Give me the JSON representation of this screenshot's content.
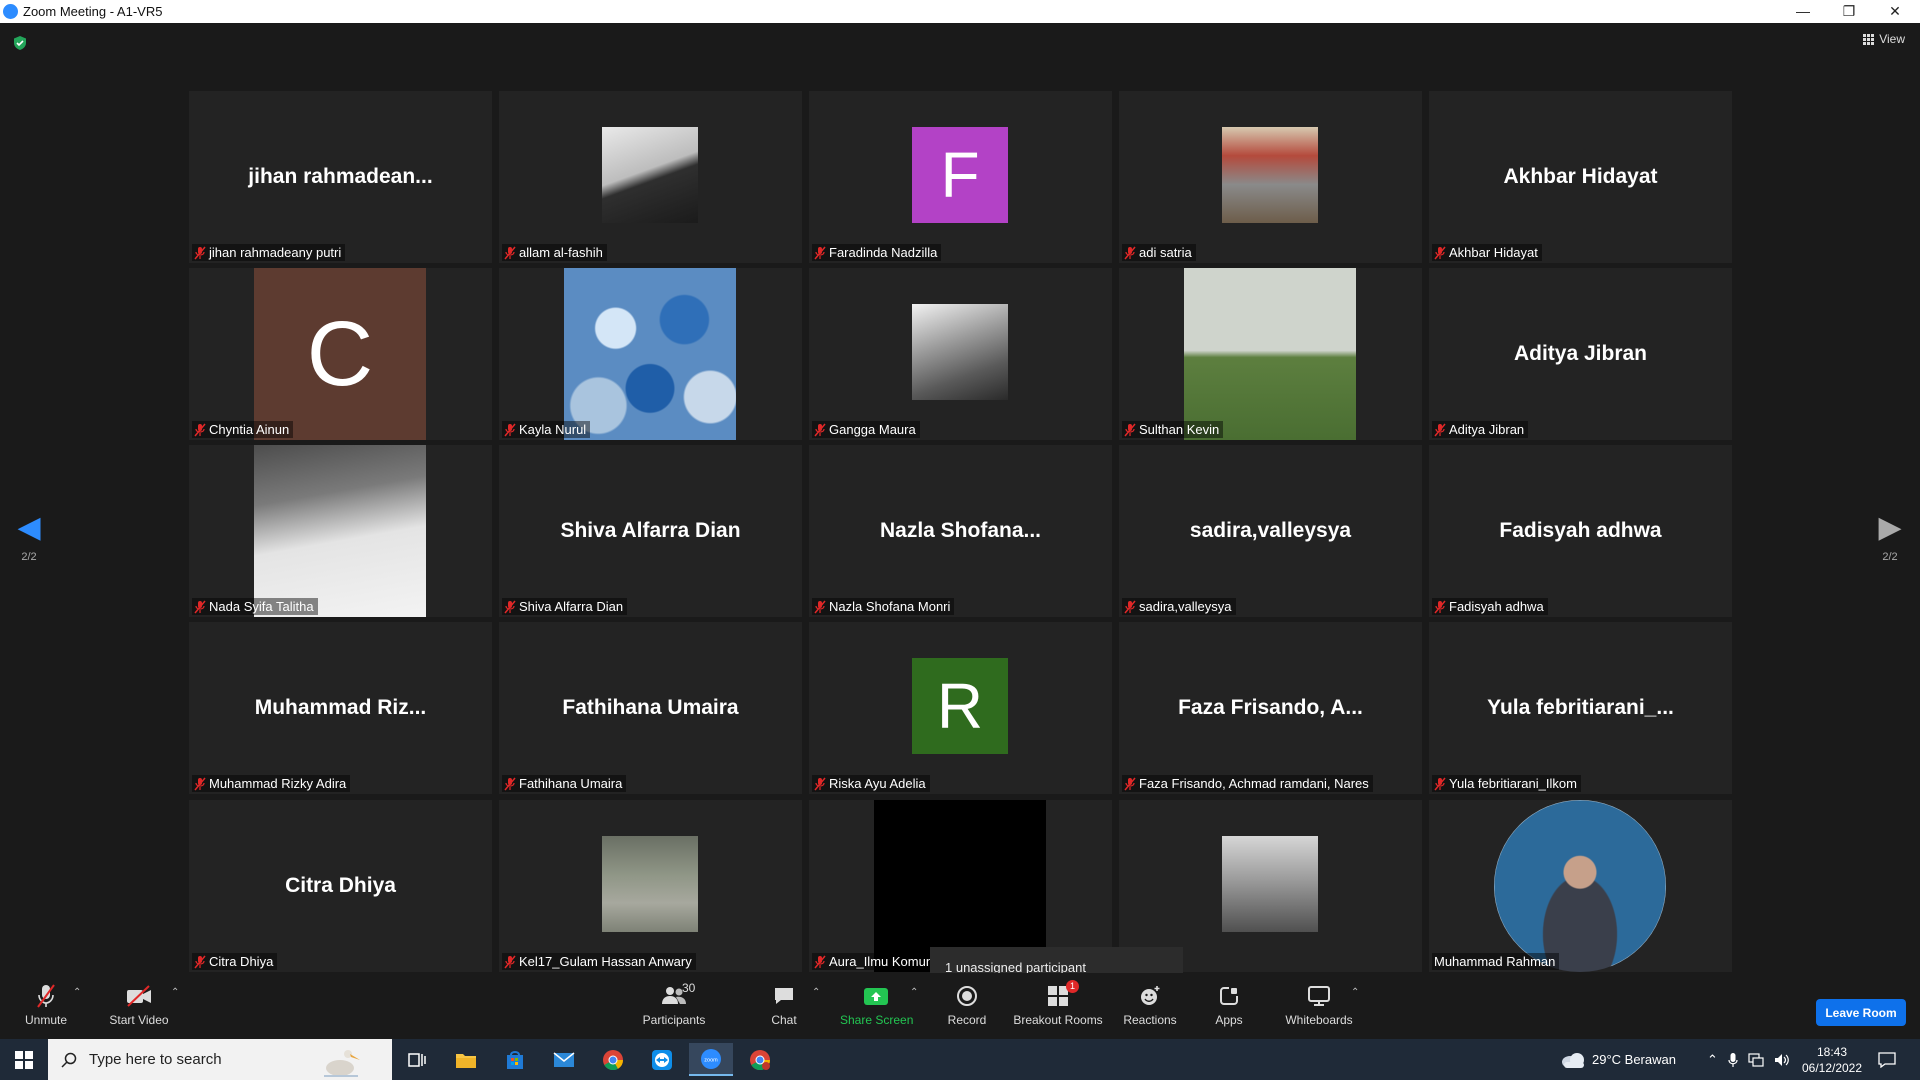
{
  "window": {
    "title": "Zoom Meeting - A1-VR5",
    "controls": [
      "minimize",
      "restore",
      "close"
    ]
  },
  "stage": {
    "view_label": "View",
    "page_indicator_left": "2/2",
    "page_indicator_right": "2/2"
  },
  "colors": {
    "accent": "#2d8cff",
    "muted_mic": "#e02828",
    "leave": "#0e71eb",
    "tile_bg": "#232323"
  },
  "tiles": [
    {
      "name": "jihan rahmadeany putri",
      "display": "jihan  rahmadean...",
      "kind": "text"
    },
    {
      "name": "allam al-fashih",
      "kind": "photo"
    },
    {
      "name": "Faradinda Nadzilla",
      "kind": "initial",
      "initial": "F",
      "color": "#b342c6"
    },
    {
      "name": "adi satria",
      "kind": "photo"
    },
    {
      "name": "Akhbar Hidayat",
      "display": "Akhbar Hidayat",
      "kind": "text"
    },
    {
      "name": "Chyntia Ainun",
      "kind": "initial",
      "initial": "C",
      "color": "#5d3b30",
      "large": true
    },
    {
      "name": "Kayla Nurul",
      "kind": "photo",
      "large": true
    },
    {
      "name": "Gangga Maura",
      "kind": "photo"
    },
    {
      "name": "Sulthan Kevin",
      "kind": "photo",
      "large": true
    },
    {
      "name": "Aditya Jibran",
      "display": "Aditya Jibran",
      "kind": "text"
    },
    {
      "name": "Nada Syifa Talitha",
      "kind": "photo",
      "large": true
    },
    {
      "name": "Shiva Alfarra Dian",
      "display": "Shiva Alfarra Dian",
      "kind": "text"
    },
    {
      "name": "Nazla Shofana Monri",
      "display": "Nazla  Shofana...",
      "kind": "text"
    },
    {
      "name": "sadira,valleysya",
      "display": "sadira,valleysya",
      "kind": "text"
    },
    {
      "name": "Fadisyah adhwa",
      "display": "Fadisyah adhwa",
      "kind": "text"
    },
    {
      "name": "Muhammad Rizky Adira",
      "display": "Muhammad  Riz...",
      "kind": "text"
    },
    {
      "name": "Fathihana Umaira",
      "display": "Fathihana Umaira",
      "kind": "text"
    },
    {
      "name": "Riska Ayu Adelia",
      "kind": "initial",
      "initial": "R",
      "color": "#2f6b1e"
    },
    {
      "name": "Faza Frisando, Achmad ramdani, Nares",
      "display": "Faza  Frisando,  A...",
      "kind": "text"
    },
    {
      "name": "Yula febritiarani_Ilkom",
      "display": "Yula  febritiarani_...",
      "kind": "text"
    },
    {
      "name": "Citra Dhiya",
      "display": "Citra Dhiya",
      "kind": "text"
    },
    {
      "name": "Kel17_Gulam Hassan Anwary",
      "kind": "photo"
    },
    {
      "name": "Aura_Ilmu Komun",
      "kind": "black",
      "large": true
    },
    {
      "name": "",
      "kind": "photo"
    },
    {
      "name": "Muhammad Rahman",
      "kind": "photo",
      "large": true,
      "circle": true,
      "nomic": true
    }
  ],
  "tooltip": "1 unassigned participant",
  "toolbar": {
    "unmute": "Unmute",
    "start_video": "Start Video",
    "participants": "Participants",
    "participants_count": "30",
    "chat": "Chat",
    "share_screen": "Share Screen",
    "record": "Record",
    "breakout_rooms": "Breakout Rooms",
    "breakout_badge": "1",
    "reactions": "Reactions",
    "apps": "Apps",
    "whiteboards": "Whiteboards",
    "leave": "Leave Room"
  },
  "taskbar": {
    "search_placeholder": "Type here to search",
    "weather": "29°C  Berawan",
    "time": "18:43",
    "date": "06/12/2022"
  }
}
